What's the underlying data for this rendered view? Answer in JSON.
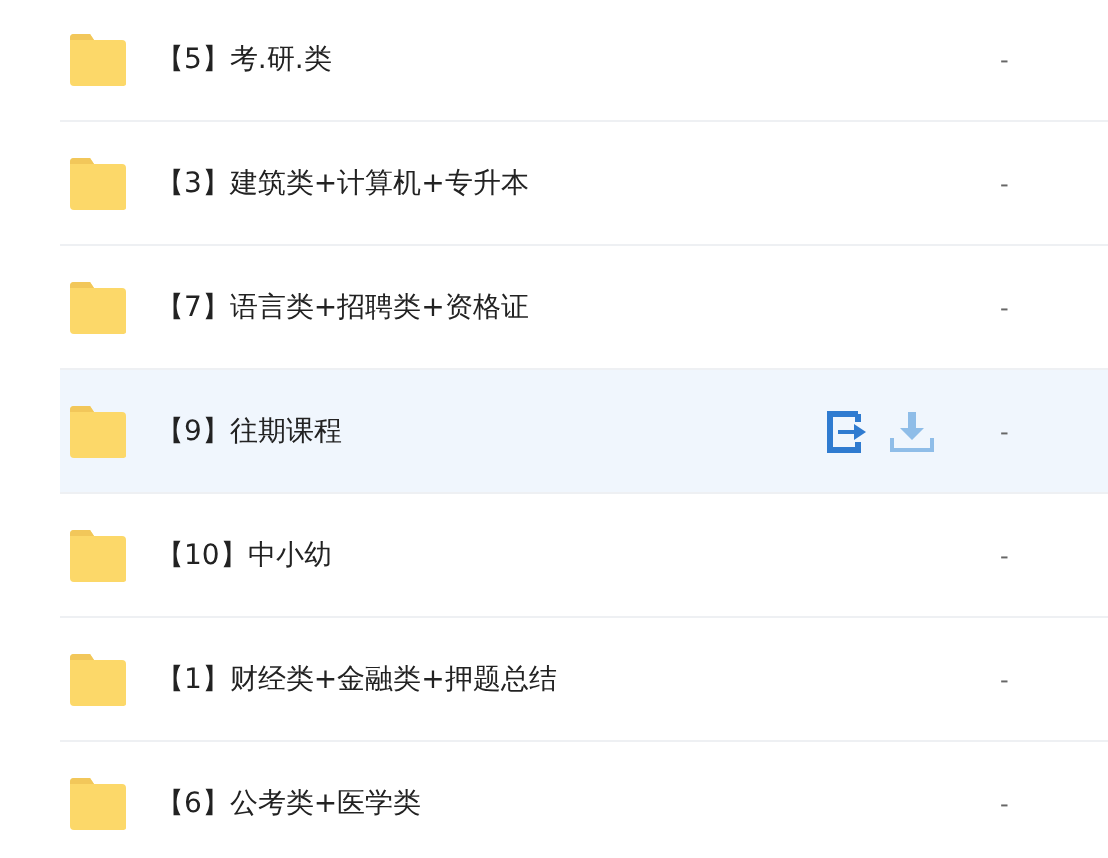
{
  "files": [
    {
      "name": "【5】考.研.类",
      "size": "-",
      "selected": false
    },
    {
      "name": "【3】建筑类+计算机+专升本",
      "size": "-",
      "selected": false
    },
    {
      "name": "【7】语言类+招聘类+资格证",
      "size": "-",
      "selected": false
    },
    {
      "name": "【9】往期课程",
      "size": "-",
      "selected": true
    },
    {
      "name": "【10】中小幼",
      "size": "-",
      "selected": false
    },
    {
      "name": "【1】财经类+金融类+押题总结",
      "size": "-",
      "selected": false
    },
    {
      "name": "【6】公考类+医学类",
      "size": "-",
      "selected": false
    }
  ]
}
